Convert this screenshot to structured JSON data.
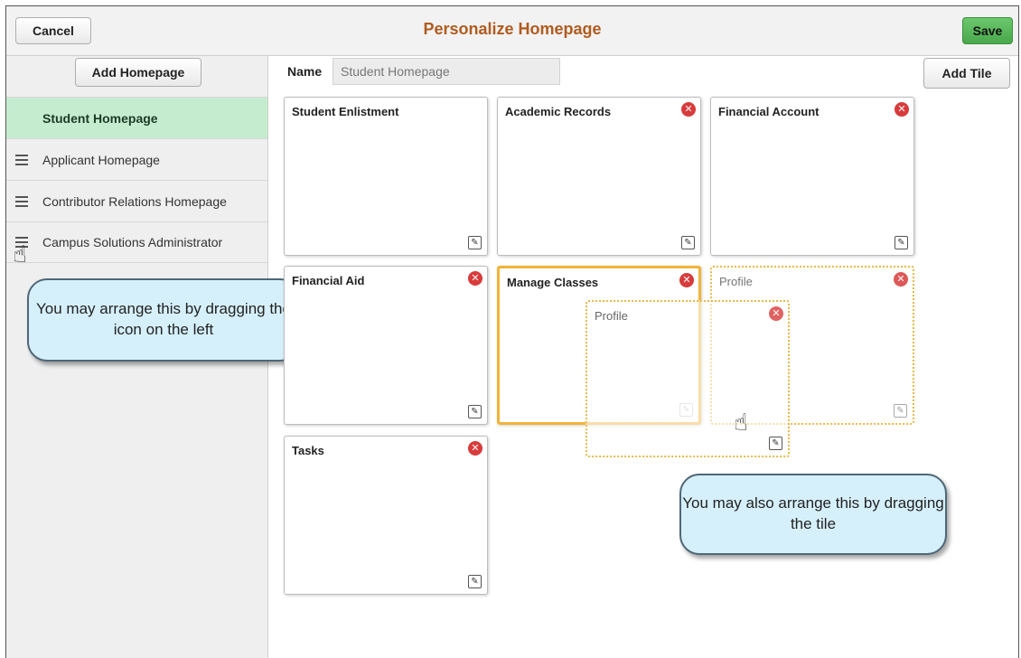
{
  "header": {
    "cancel_label": "Cancel",
    "title": "Personalize Homepage",
    "save_label": "Save"
  },
  "sidebar": {
    "add_homepage_label": "Add Homepage",
    "items": [
      {
        "label": "Student Homepage",
        "active": true
      },
      {
        "label": "Applicant Homepage",
        "active": false
      },
      {
        "label": "Contributor Relations Homepage",
        "active": false
      },
      {
        "label": "Campus Solutions Administrator",
        "active": false
      }
    ]
  },
  "main": {
    "name_label": "Name",
    "name_value": "Student Homepage",
    "add_tile_label": "Add Tile",
    "tiles": [
      {
        "name": "Student Enlistment",
        "removable": false
      },
      {
        "name": "Academic Records",
        "removable": true
      },
      {
        "name": "Financial Account",
        "removable": true
      },
      {
        "name": "Financial Aid",
        "removable": true
      },
      {
        "name": "Manage Classes",
        "removable": true,
        "state": "selected"
      },
      {
        "name": "Profile",
        "removable": true,
        "state": "placeholder"
      },
      {
        "name": "Tasks",
        "removable": true
      }
    ],
    "dragging_tile": {
      "name": "Profile"
    }
  },
  "callouts": {
    "sidebar_tip": "You may arrange this by dragging the icon on the left",
    "tile_tip": "You may also arrange this by dragging the tile"
  },
  "icons": {
    "close": "close-circle-icon",
    "edit": "edit-icon",
    "grip": "drag-handle-icon",
    "cursor": "grab-hand-icon"
  },
  "colors": {
    "title": "#b05b1f",
    "save_button": "#49a84b",
    "active_sidebar": "#c6ecd0",
    "selected_tile_border": "#f0b43a",
    "close_icon": "#d83b3b",
    "callout_bg": "#d6f0fb"
  }
}
